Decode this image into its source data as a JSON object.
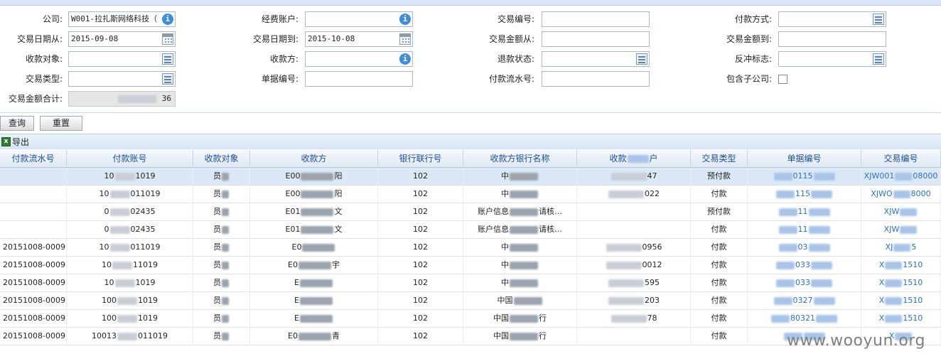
{
  "filters": {
    "row1": [
      {
        "label": "公司:",
        "value": "W001-拉扎斯网络科技（",
        "icon": "info-icon"
      },
      {
        "label": "经费账户:",
        "value": "",
        "icon": "info-icon"
      },
      {
        "label": "交易编号:",
        "value": ""
      },
      {
        "label": "付款方式:",
        "value": "",
        "icon": "list-icon"
      }
    ],
    "row2": [
      {
        "label": "交易日期从:",
        "value": "2015-09-08",
        "icon": "calendar-icon"
      },
      {
        "label": "交易日期到:",
        "value": "2015-10-08",
        "icon": "calendar-icon"
      },
      {
        "label": "交易金额从:",
        "value": ""
      },
      {
        "label": "交易金额到:",
        "value": ""
      }
    ],
    "row3": [
      {
        "label": "收款对象:",
        "value": "",
        "icon": "list-icon"
      },
      {
        "label": "收款方:",
        "value": "",
        "icon": "info-icon"
      },
      {
        "label": "退款状态:",
        "value": "",
        "icon": "list-icon"
      },
      {
        "label": "反冲标志:",
        "value": "",
        "icon": "list-icon"
      }
    ],
    "row4": [
      {
        "label": "交易类型:",
        "value": "",
        "icon": "list-icon"
      },
      {
        "label": "单据编号:",
        "value": ""
      },
      {
        "label": "付款流水号:",
        "value": ""
      },
      {
        "label": "包含子公司:",
        "value": "",
        "checkbox": true
      }
    ],
    "total": {
      "label": "交易金额合计:",
      "value": "36"
    }
  },
  "buttons": {
    "query": "查询",
    "reset": "重置"
  },
  "export": {
    "label": "导出"
  },
  "table": {
    "columns": [
      "付款流水号",
      "付款账号",
      "收款对象",
      "收款方",
      "银行联行号",
      "收款方银行名称",
      "收款",
      "交易类型",
      "单据编号",
      "交易编号"
    ],
    "rows": [
      {
        "serial": "",
        "account_pre": "10",
        "account_suf": "1019",
        "target": "员",
        "payee_pre": "E00",
        "payee_suf": "阳",
        "bank_no": "102",
        "bank_pre": "中",
        "bank_suf": "",
        "acct2_pre": "",
        "acct2_suf": "47",
        "type": "预付款",
        "doc_pre": "",
        "doc_suf": "0115",
        "txn_pre": "XJW001",
        "txn_suf": "08000"
      },
      {
        "serial": "",
        "account_pre": "10",
        "account_suf": "011019",
        "target": "员",
        "payee_pre": "E00",
        "payee_suf": "阳",
        "bank_no": "102",
        "bank_pre": "中",
        "bank_suf": "",
        "acct2_pre": "",
        "acct2_suf": "022",
        "type": "付款",
        "doc_pre": "",
        "doc_suf": "115",
        "txn_pre": "XJWO",
        "txn_suf": "8000"
      },
      {
        "serial": "",
        "account_pre": "0",
        "account_suf": "02435",
        "target": "员",
        "payee_pre": "E01",
        "payee_suf": "文",
        "bank_no": "102",
        "bank_pre": "账户信息",
        "bank_suf": "请核…",
        "acct2_pre": "",
        "acct2_suf": "",
        "type": "预付款",
        "doc_pre": "",
        "doc_suf": "11",
        "txn_pre": "XJW",
        "txn_suf": ""
      },
      {
        "serial": "",
        "account_pre": "0",
        "account_suf": "02435",
        "target": "员",
        "payee_pre": "E01",
        "payee_suf": "文",
        "bank_no": "102",
        "bank_pre": "账户信息",
        "bank_suf": "请核…",
        "acct2_pre": "",
        "acct2_suf": "",
        "type": "付款",
        "doc_pre": "",
        "doc_suf": "11",
        "txn_pre": "XJW",
        "txn_suf": ""
      },
      {
        "serial": "20151008-0009",
        "account_pre": "10",
        "account_suf": "011019",
        "target": "员",
        "payee_pre": "E0",
        "payee_suf": "",
        "bank_no": "102",
        "bank_pre": "中",
        "bank_suf": "",
        "acct2_pre": "",
        "acct2_suf": "0956",
        "type": "付款",
        "doc_pre": "",
        "doc_suf": "03",
        "txn_pre": "XJ",
        "txn_suf": "5"
      },
      {
        "serial": "20151008-0009",
        "account_pre": "10",
        "account_suf": "11019",
        "target": "员",
        "payee_pre": "E0",
        "payee_suf": "宇",
        "bank_no": "102",
        "bank_pre": "中",
        "bank_suf": "",
        "acct2_pre": "",
        "acct2_suf": "0012",
        "type": "付款",
        "doc_pre": "",
        "doc_suf": "033",
        "txn_pre": "X",
        "txn_suf": "1510"
      },
      {
        "serial": "20151008-0009",
        "account_pre": "10",
        "account_suf": "1019",
        "target": "员",
        "payee_pre": "E",
        "payee_suf": "",
        "bank_no": "102",
        "bank_pre": "中",
        "bank_suf": "",
        "acct2_pre": "",
        "acct2_suf": "595",
        "type": "付款",
        "doc_pre": "",
        "doc_suf": "033",
        "txn_pre": "X",
        "txn_suf": "1510"
      },
      {
        "serial": "20151008-0009",
        "account_pre": "100",
        "account_suf": "1019",
        "target": "员",
        "payee_pre": "E",
        "payee_suf": "",
        "bank_no": "102",
        "bank_pre": "中国",
        "bank_suf": "",
        "acct2_pre": "",
        "acct2_suf": "203",
        "type": "付款",
        "doc_pre": "",
        "doc_suf": "0327",
        "txn_pre": "X",
        "txn_suf": "1510"
      },
      {
        "serial": "20151008-0009",
        "account_pre": "100",
        "account_suf": "1019",
        "target": "员",
        "payee_pre": "E",
        "payee_suf": "",
        "bank_no": "102",
        "bank_pre": "中国",
        "bank_suf": "行",
        "acct2_pre": "",
        "acct2_suf": "78",
        "type": "付款",
        "doc_pre": "",
        "doc_suf": "80321",
        "txn_pre": "X",
        "txn_suf": "1510"
      },
      {
        "serial": "20151008-0009",
        "account_pre": "10013",
        "account_suf": "011019",
        "target": "员",
        "payee_pre": "E0",
        "payee_suf": "青",
        "bank_no": "102",
        "bank_pre": "中国",
        "bank_suf": "行",
        "acct2_pre": "",
        "acct2_suf": "",
        "type": "付款",
        "doc_pre": "",
        "doc_suf": "",
        "txn_pre": "X",
        "txn_suf": ""
      }
    ]
  },
  "watermark": "www.wooyun.org",
  "colors": {
    "header_text": "#1a4f9c",
    "link": "#2a6fc9",
    "selected_row": "#dbe8f6"
  }
}
